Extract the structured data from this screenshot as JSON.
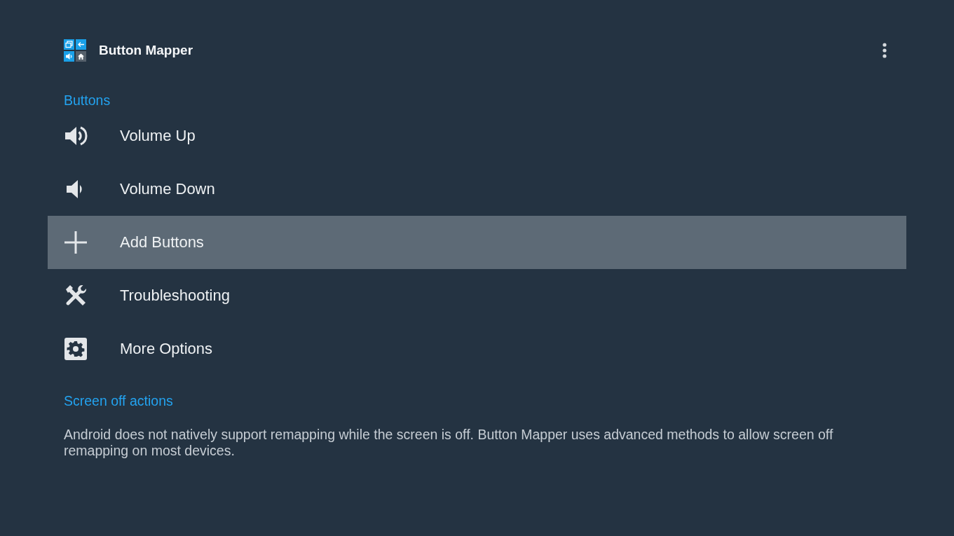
{
  "app_bar": {
    "title": "Button Mapper"
  },
  "sections": [
    {
      "header": "Buttons",
      "items": [
        {
          "label": "Volume Up",
          "selected": false
        },
        {
          "label": "Volume Down",
          "selected": false
        },
        {
          "label": "Add Buttons",
          "selected": true
        },
        {
          "label": "Troubleshooting",
          "selected": false
        },
        {
          "label": "More Options",
          "selected": false
        }
      ]
    },
    {
      "header": "Screen off actions",
      "description": "Android does not natively support remapping while the screen is off. Button Mapper uses advanced methods to allow screen off remapping on most devices."
    }
  ]
}
